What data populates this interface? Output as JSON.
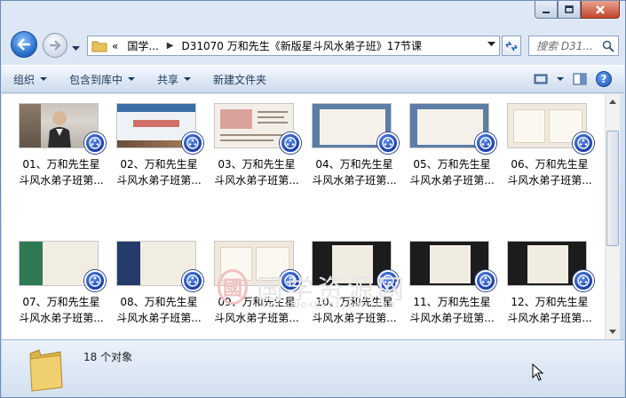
{
  "address": {
    "overflow_label": "«",
    "crumbs": [
      "国学...",
      "D31070 万和先生《新版星斗风水弟子班》17节课"
    ]
  },
  "search": {
    "placeholder": "搜索 D31..."
  },
  "toolbar": {
    "organize": "组织",
    "include_in_library": "包含到库中",
    "share": "共享",
    "new_folder": "新建文件夹"
  },
  "files": [
    {
      "line1": "01、万和先生星",
      "line2": "斗风水弟子班第...",
      "thumb": "photo"
    },
    {
      "line1": "02、万和先生星",
      "line2": "斗风水弟子班第...",
      "thumb": "slide-blue"
    },
    {
      "line1": "03、万和先生星",
      "line2": "斗风水弟子班第...",
      "thumb": "slide-red"
    },
    {
      "line1": "04、万和先生星",
      "line2": "斗风水弟子班第...",
      "thumb": "slide-bg"
    },
    {
      "line1": "05、万和先生星",
      "line2": "斗风水弟子班第...",
      "thumb": "slide-bg"
    },
    {
      "line1": "06、万和先生星",
      "line2": "斗风水弟子班第...",
      "thumb": "slide-cream"
    },
    {
      "line1": "07、万和先生星",
      "line2": "斗风水弟子班第...",
      "thumb": "green"
    },
    {
      "line1": "08、万和先生星",
      "line2": "斗风水弟子班第...",
      "thumb": "navy"
    },
    {
      "line1": "09、万和先生星",
      "line2": "斗风水弟子班第...",
      "thumb": "slide-cream"
    },
    {
      "line1": "10、万和先生星",
      "line2": "斗风水弟子班第...",
      "thumb": "dark"
    },
    {
      "line1": "11、万和先生星",
      "line2": "斗风水弟子班第...",
      "thumb": "dark"
    },
    {
      "line1": "12、万和先生星",
      "line2": "斗风水弟子班第...",
      "thumb": "dark"
    }
  ],
  "watermark": {
    "logo": "國",
    "text": "国学资源网",
    "url": "www.guoxueziyuan.com"
  },
  "details": {
    "count": "18 个对象"
  },
  "colors": {
    "badge": "#1a3fa8",
    "accent": "#1e395b",
    "close": "#c4452c"
  }
}
